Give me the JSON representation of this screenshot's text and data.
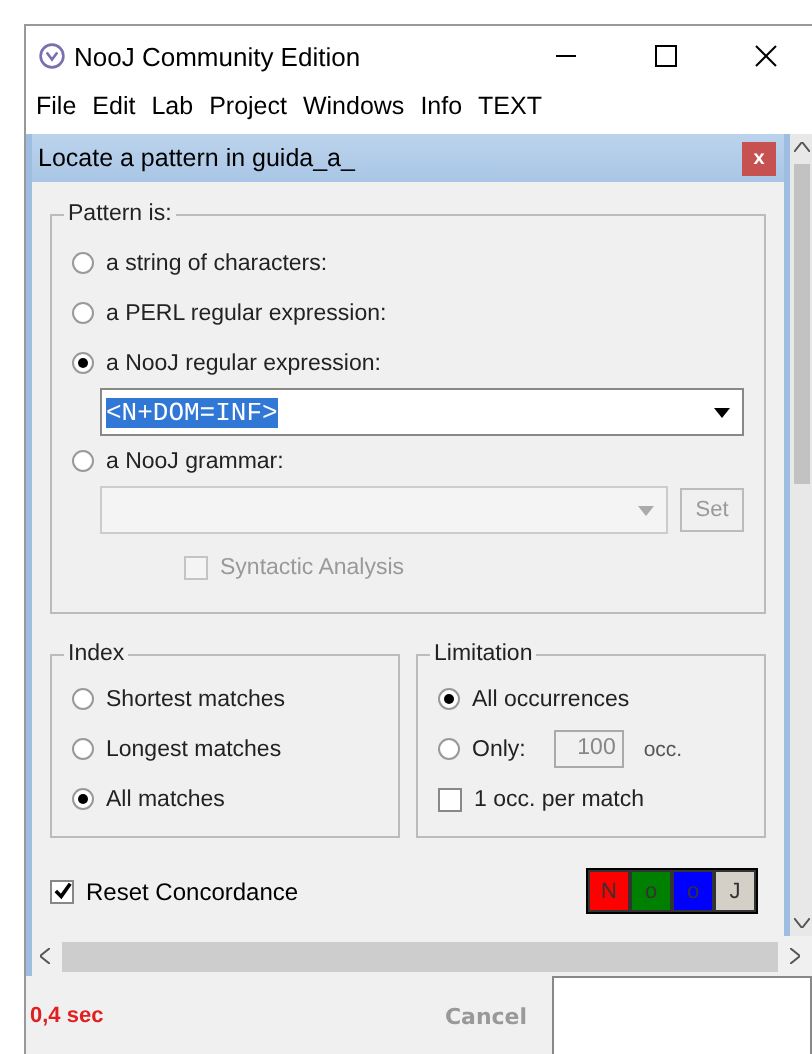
{
  "window": {
    "title": "NooJ Community Edition"
  },
  "menu": [
    "File",
    "Edit",
    "Lab",
    "Project",
    "Windows",
    "Info",
    "TEXT"
  ],
  "dialog": {
    "title": "Locate a pattern in guida_a_",
    "close": "x"
  },
  "pattern": {
    "legend": "Pattern is:",
    "options": [
      {
        "label": "a string of characters:",
        "selected": false
      },
      {
        "label": "a PERL regular expression:",
        "selected": false
      },
      {
        "label": "a NooJ regular expression:",
        "selected": true
      },
      {
        "label": "a NooJ grammar:",
        "selected": false
      }
    ],
    "expression": "<N+DOM=INF>",
    "set_button": "Set",
    "syntactic": {
      "label": "Syntactic Analysis",
      "checked": false,
      "disabled": true
    }
  },
  "index": {
    "legend": "Index",
    "options": [
      {
        "label": "Shortest matches",
        "selected": false
      },
      {
        "label": "Longest matches",
        "selected": false
      },
      {
        "label": "All matches",
        "selected": true
      }
    ]
  },
  "limitation": {
    "legend": "Limitation",
    "options": [
      {
        "label": "All occurrences",
        "selected": true
      },
      {
        "label": "Only:",
        "selected": false
      }
    ],
    "count": "100",
    "unit": "occ.",
    "per_match": {
      "label": "1 occ. per match",
      "checked": false
    }
  },
  "reset": {
    "label": "Reset Concordance",
    "checked": true
  },
  "color_buttons": [
    {
      "label": "N",
      "color": "#ff0000"
    },
    {
      "label": "o",
      "color": "#008000"
    },
    {
      "label": "o",
      "color": "#0000ff"
    },
    {
      "label": "J",
      "color": "#d4d0c8"
    }
  ],
  "status": {
    "time": "0,4 sec",
    "cancel": "Cancel"
  }
}
